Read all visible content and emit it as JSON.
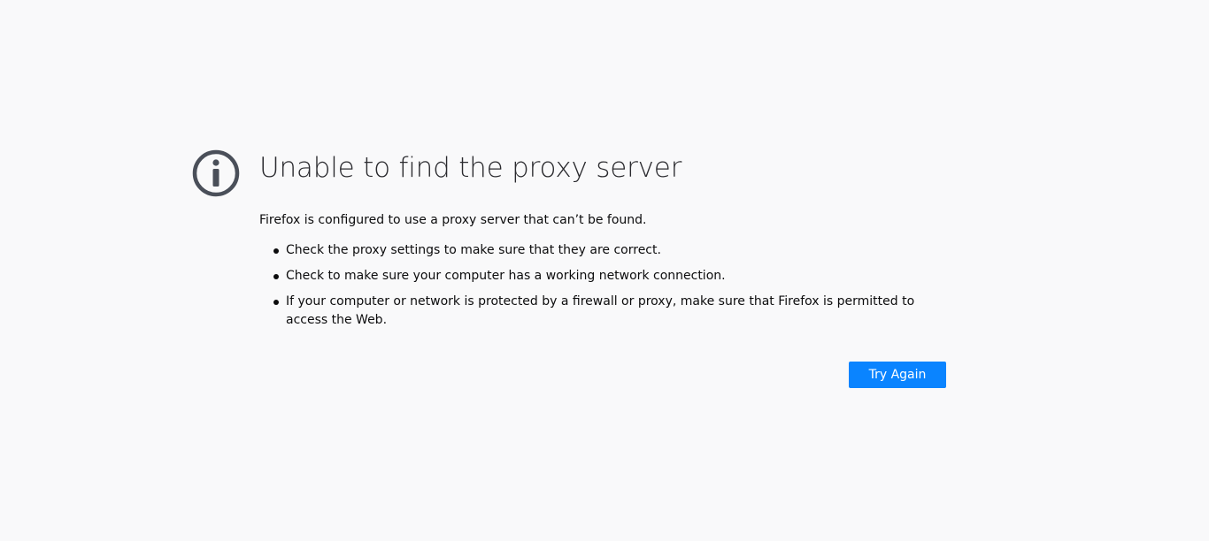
{
  "error_page": {
    "icon": "info-icon",
    "title": "Unable to find the proxy server",
    "description": "Firefox is configured to use a proxy server that can’t be found.",
    "tips": [
      "Check the proxy settings to make sure that they are correct.",
      "Check to make sure your computer has a working network connection.",
      "If your computer or network is protected by a firewall or proxy, make sure that Firefox is permitted to access the Web."
    ],
    "try_again_label": "Try Again"
  },
  "colors": {
    "background": "#f9f9fa",
    "icon": "#4a4f59",
    "button": "#0a84ff",
    "button_text": "#ffffff"
  }
}
